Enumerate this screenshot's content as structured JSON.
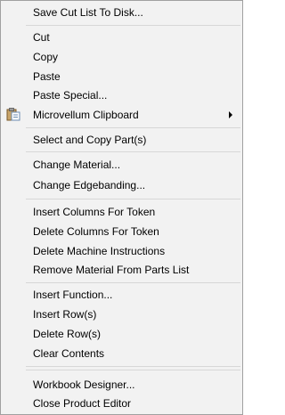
{
  "menu": {
    "items": {
      "save_cut_list": "Save Cut List To Disk...",
      "cut": "Cut",
      "copy": "Copy",
      "paste": "Paste",
      "paste_special": "Paste Special...",
      "microvellum_clipboard": "Microvellum Clipboard",
      "select_copy_parts": "Select and Copy Part(s)",
      "change_material": "Change Material...",
      "change_edgebanding": "Change Edgebanding...",
      "insert_columns_token": "Insert Columns For Token",
      "delete_columns_token": "Delete Columns For Token",
      "delete_machine_instructions": "Delete Machine Instructions",
      "remove_material": "Remove Material From Parts List",
      "insert_function": "Insert Function...",
      "insert_rows": "Insert Row(s)",
      "delete_rows": "Delete Row(s)",
      "clear_contents": "Clear Contents",
      "workbook_designer": "Workbook Designer...",
      "close_product_editor": "Close Product Editor"
    },
    "icons": {
      "clipboard": "clipboard-icon",
      "submenu_arrow": "chevron-right-icon"
    },
    "colors": {
      "background": "#f2f2f2",
      "border": "#a0a0a0",
      "separator": "#d7d7d7",
      "text": "#000000"
    }
  }
}
